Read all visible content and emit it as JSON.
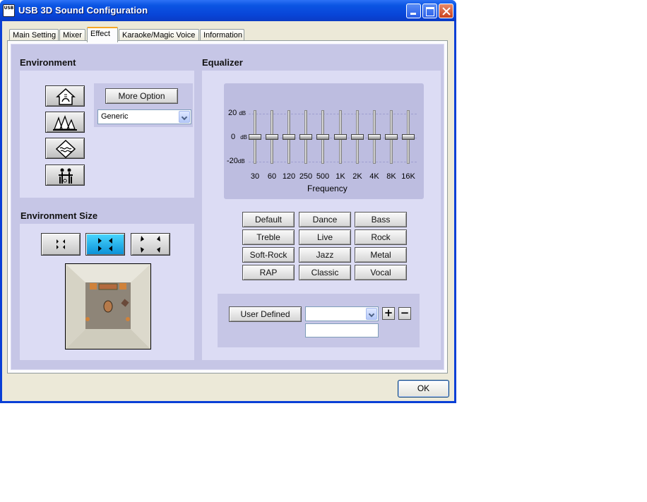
{
  "window": {
    "title": "USB 3D Sound Configuration",
    "app_icon_text": "USB"
  },
  "tabs": [
    {
      "label": "Main Setting"
    },
    {
      "label": "Mixer"
    },
    {
      "label": "Effect",
      "selected": true
    },
    {
      "label": "Karaoke/Magic Voice"
    },
    {
      "label": "Information"
    }
  ],
  "environment": {
    "title": "Environment",
    "buttons": [
      "house-icon",
      "opera-house-icon",
      "underwater-icon",
      "room-icon"
    ],
    "more_option_label": "More Option",
    "preset": "Generic"
  },
  "environment_size": {
    "title": "Environment Size",
    "buttons": [
      {
        "icon": "size-small-icon"
      },
      {
        "icon": "size-medium-icon",
        "selected": true
      },
      {
        "icon": "size-large-icon"
      }
    ]
  },
  "equalizer": {
    "title": "Equalizer",
    "db_labels": {
      "top": "20",
      "mid": "0",
      "bottom": "-20",
      "unit": "dB"
    },
    "bands": [
      {
        "freq": "30",
        "value_db": 0
      },
      {
        "freq": "60",
        "value_db": 0
      },
      {
        "freq": "120",
        "value_db": 0
      },
      {
        "freq": "250",
        "value_db": 0
      },
      {
        "freq": "500",
        "value_db": 0
      },
      {
        "freq": "1K",
        "value_db": 0
      },
      {
        "freq": "2K",
        "value_db": 0
      },
      {
        "freq": "4K",
        "value_db": 0
      },
      {
        "freq": "8K",
        "value_db": 0
      },
      {
        "freq": "16K",
        "value_db": 0
      }
    ],
    "frequency_label": "Frequency",
    "presets": [
      [
        "Default",
        "Dance",
        "Bass"
      ],
      [
        "Treble",
        "Live",
        "Rock"
      ],
      [
        "Soft-Rock",
        "Jazz",
        "Metal"
      ],
      [
        "RAP",
        "Classic",
        "Vocal"
      ]
    ],
    "user_defined": {
      "label": "User  Defined",
      "selected": "",
      "name_value": "",
      "add_symbol": "+",
      "remove_symbol": "−"
    }
  },
  "footer": {
    "ok_label": "OK"
  }
}
